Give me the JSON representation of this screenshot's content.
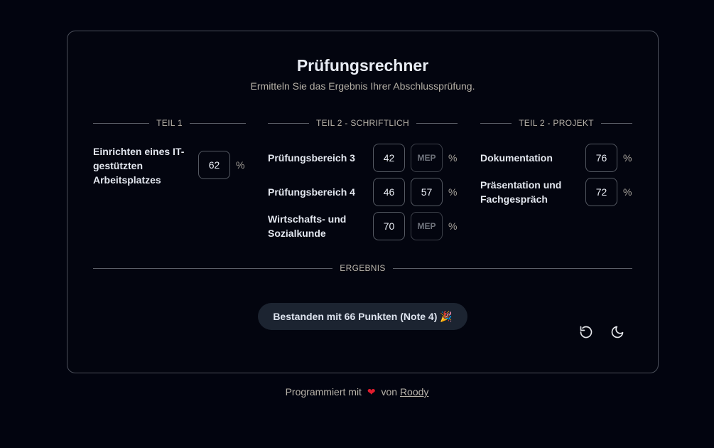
{
  "header": {
    "title": "Prüfungsrechner",
    "subtitle": "Ermitteln Sie das Ergebnis Ihrer Abschlussprüfung."
  },
  "sections": {
    "teil1": "TEIL 1",
    "teil2_schriftlich": "TEIL 2 - SCHRIFTLICH",
    "teil2_projekt": "TEIL 2 - PROJEKT",
    "ergebnis": "ERGEBNIS"
  },
  "teil1": {
    "label": "Einrichten eines IT-gestützten Arbeitsplatzes",
    "value": "62",
    "unit": "%"
  },
  "schriftlich": [
    {
      "label": "Prüfungsbereich 3",
      "value": "42",
      "mep": "",
      "mep_placeholder": "MEP",
      "unit": "%"
    },
    {
      "label": "Prüfungsbereich 4",
      "value": "46",
      "mep": "57",
      "mep_placeholder": "MEP",
      "unit": "%"
    },
    {
      "label": "Wirtschafts- und Sozialkunde",
      "value": "70",
      "mep": "",
      "mep_placeholder": "MEP",
      "unit": "%"
    }
  ],
  "projekt": [
    {
      "label": "Dokumentation",
      "value": "76",
      "unit": "%"
    },
    {
      "label": "Präsentation und Fachgespräch",
      "value": "72",
      "unit": "%"
    }
  ],
  "result": {
    "text": "Bestanden mit 66 Punkten (Note 4) 🎉"
  },
  "footer": {
    "prefix": "Programmiert mit",
    "heart": "❤",
    "by": "von",
    "author": "Roody"
  },
  "icons": {
    "reset": "reset-icon",
    "theme": "moon-icon"
  }
}
